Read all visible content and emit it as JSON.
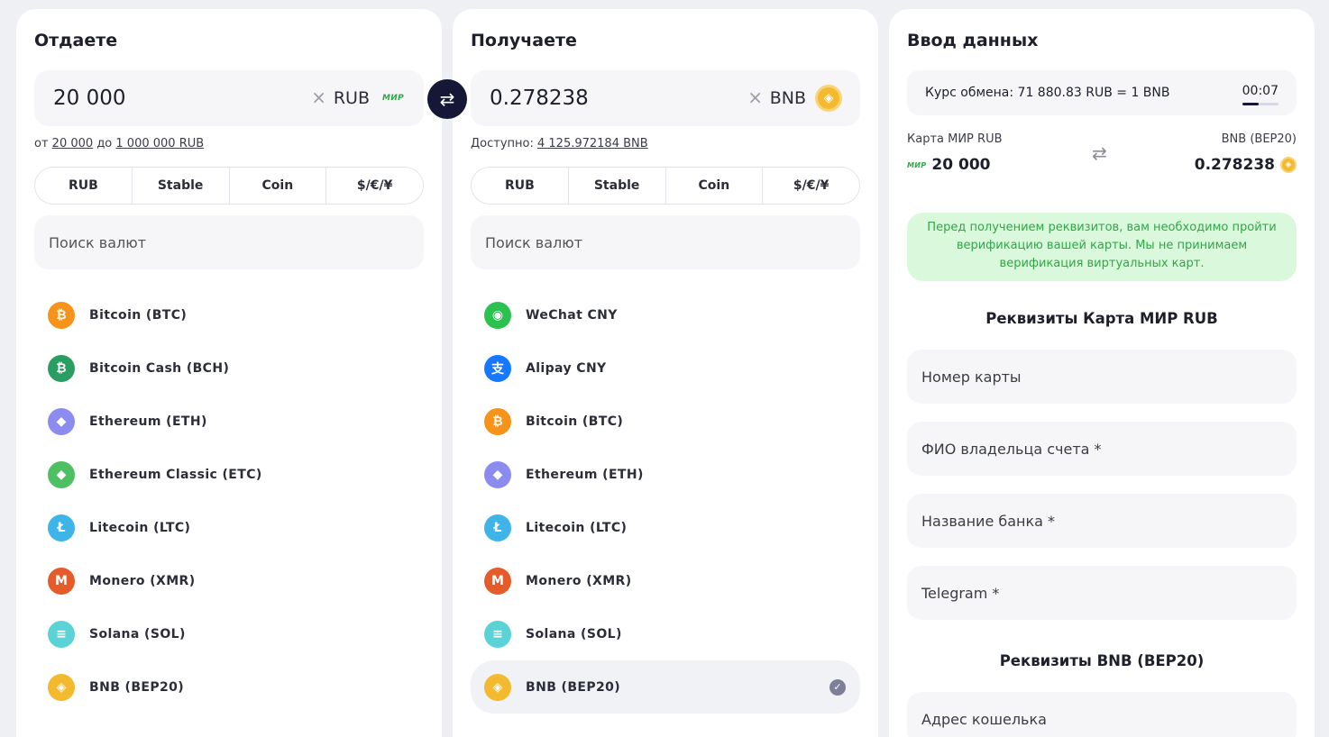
{
  "give": {
    "title": "Отдаете",
    "amount": "20 000",
    "clear": "×",
    "currency": "RUB",
    "currency_badge": "МИР",
    "limits_from": "от",
    "limits_min": "20 000",
    "limits_to": "до",
    "limits_max": "1 000 000 RUB",
    "tabs": [
      "RUB",
      "Stable",
      "Coin",
      "$/€/¥"
    ],
    "search_placeholder": "Поиск валют",
    "items": [
      {
        "label": "Bitcoin (BTC)",
        "icon": "bitcoin-icon",
        "color": "#f7931a",
        "glyph": "₿"
      },
      {
        "label": "Bitcoin Cash (BCH)",
        "icon": "bitcoin-cash-icon",
        "color": "#2a9d62",
        "glyph": "₿"
      },
      {
        "label": "Ethereum (ETH)",
        "icon": "ethereum-icon",
        "color": "#8c8cf0",
        "glyph": "◆"
      },
      {
        "label": "Ethereum Classic (ETC)",
        "icon": "ethereum-classic-icon",
        "color": "#4fbf63",
        "glyph": "◆"
      },
      {
        "label": "Litecoin (LTC)",
        "icon": "litecoin-icon",
        "color": "#3fb4e8",
        "glyph": "Ł"
      },
      {
        "label": "Monero (XMR)",
        "icon": "monero-icon",
        "color": "#e65b2a",
        "glyph": "M"
      },
      {
        "label": "Solana (SOL)",
        "icon": "solana-icon",
        "color": "#5bd3d6",
        "glyph": "≡"
      },
      {
        "label": "BNB (BEP20)",
        "icon": "bnb-icon",
        "color": "#f3ba2f",
        "glyph": "◈"
      }
    ]
  },
  "receive": {
    "title": "Получаете",
    "amount": "0.278238",
    "clear": "×",
    "currency": "BNB",
    "available_label": "Доступно:",
    "available_value": "4 125.972184 BNB",
    "tabs": [
      "RUB",
      "Stable",
      "Coin",
      "$/€/¥"
    ],
    "search_placeholder": "Поиск валют",
    "items": [
      {
        "label": "WeChat CNY",
        "icon": "wechat-icon",
        "color": "#2ac14e",
        "glyph": "◉"
      },
      {
        "label": "Alipay CNY",
        "icon": "alipay-icon",
        "color": "#1677ff",
        "glyph": "支"
      },
      {
        "label": "Bitcoin (BTC)",
        "icon": "bitcoin-icon",
        "color": "#f7931a",
        "glyph": "₿"
      },
      {
        "label": "Ethereum (ETH)",
        "icon": "ethereum-icon",
        "color": "#8c8cf0",
        "glyph": "◆"
      },
      {
        "label": "Litecoin (LTC)",
        "icon": "litecoin-icon",
        "color": "#3fb4e8",
        "glyph": "Ł"
      },
      {
        "label": "Monero (XMR)",
        "icon": "monero-icon",
        "color": "#e65b2a",
        "glyph": "M"
      },
      {
        "label": "Solana (SOL)",
        "icon": "solana-icon",
        "color": "#5bd3d6",
        "glyph": "≡"
      },
      {
        "label": "BNB (BEP20)",
        "icon": "bnb-icon",
        "color": "#f3ba2f",
        "glyph": "◈",
        "selected": true
      }
    ]
  },
  "details": {
    "title": "Ввод данных",
    "rate_text": "Курс обмена: 71 880.83 RUB = 1 BNB",
    "timer": "00:07",
    "timer_progress": 0.45,
    "from_label": "Карта МИР RUB",
    "from_value": "20 000",
    "to_label": "BNB (BEP20)",
    "to_value": "0.278238",
    "notice": "Перед получением реквизитов, вам необходимо пройти верификацию вашей карты. Мы не принимаем верификация виртуальных карт.",
    "card_section_title": "Реквизиты Карта МИР RUB",
    "card_number_placeholder": "Номер карты",
    "holder_placeholder": "ФИО владельца счета *",
    "bank_placeholder": "Название банка *",
    "telegram_placeholder": "Telegram *",
    "bnb_section_title": "Реквизиты BNB (BEP20)",
    "wallet_placeholder": "Адрес кошелька"
  },
  "colors": {
    "accent": "#141736",
    "notice_bg": "#d9f8dc",
    "notice_text": "#2fa845"
  }
}
